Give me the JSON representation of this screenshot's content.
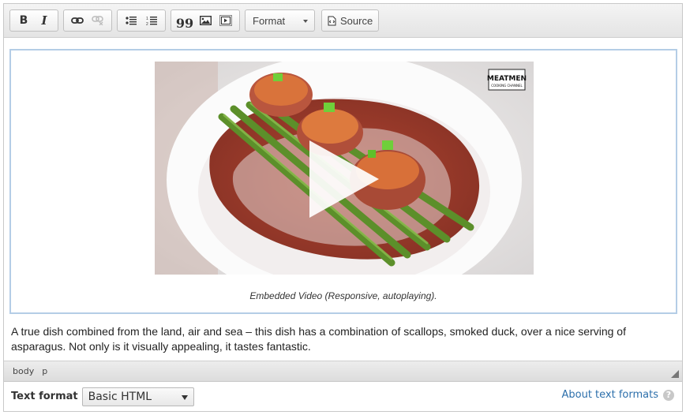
{
  "toolbar": {
    "buttons": [
      {
        "name": "bold",
        "glyph": "B"
      },
      {
        "name": "italic",
        "glyph": "I"
      },
      {
        "name": "link"
      },
      {
        "name": "unlink"
      },
      {
        "name": "bulleted-list"
      },
      {
        "name": "numbered-list"
      },
      {
        "name": "blockquote",
        "glyph": "99"
      },
      {
        "name": "image"
      },
      {
        "name": "video-embed"
      }
    ],
    "format_label": "Format",
    "source_label": "Source"
  },
  "content": {
    "video": {
      "watermark_title": "MEATMEN",
      "watermark_subtitle": "COOKING CHANNEL",
      "caption": "Embedded Video (Responsive, autoplaying)."
    },
    "paragraph": "A true dish combined from the land, air and sea – this dish has a combination of scallops, smoked duck, over a nice serving of asparagus. Not only is it visually appealing, it tastes fantastic."
  },
  "pathbar": {
    "items": [
      "body",
      "p"
    ]
  },
  "footer": {
    "text_format_label": "Text format",
    "text_format_value": "Basic HTML",
    "about_link": "About text formats",
    "help_glyph": "?"
  }
}
